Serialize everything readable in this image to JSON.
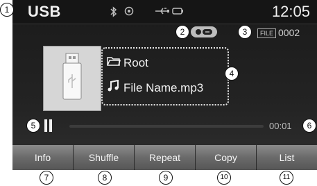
{
  "status_bar": {
    "mode": "USB",
    "clock": "12:05",
    "icons": [
      "bluetooth-icon",
      "record-icon",
      "usb-icon",
      "battery-icon"
    ]
  },
  "track": {
    "file_badge": "FILE",
    "file_number": "0002",
    "folder_name": "Root",
    "file_name": "File Name.mp3",
    "elapsed_time": "00:01",
    "progress": 0.0
  },
  "softkeys": {
    "info": "Info",
    "shuffle": "Shuffle",
    "repeat": "Repeat",
    "copy": "Copy",
    "list": "List"
  },
  "callouts": {
    "c1": "1",
    "c2": "2",
    "c3": "3",
    "c4": "4",
    "c5": "5",
    "c6": "6",
    "c7": "7",
    "c8": "8",
    "c9": "9",
    "c10": "10",
    "c11": "11"
  },
  "colors": {
    "screen_bg": "#1c1c1c",
    "softkey_bg": "#6a6a6a",
    "text": "#f0f0f0"
  }
}
